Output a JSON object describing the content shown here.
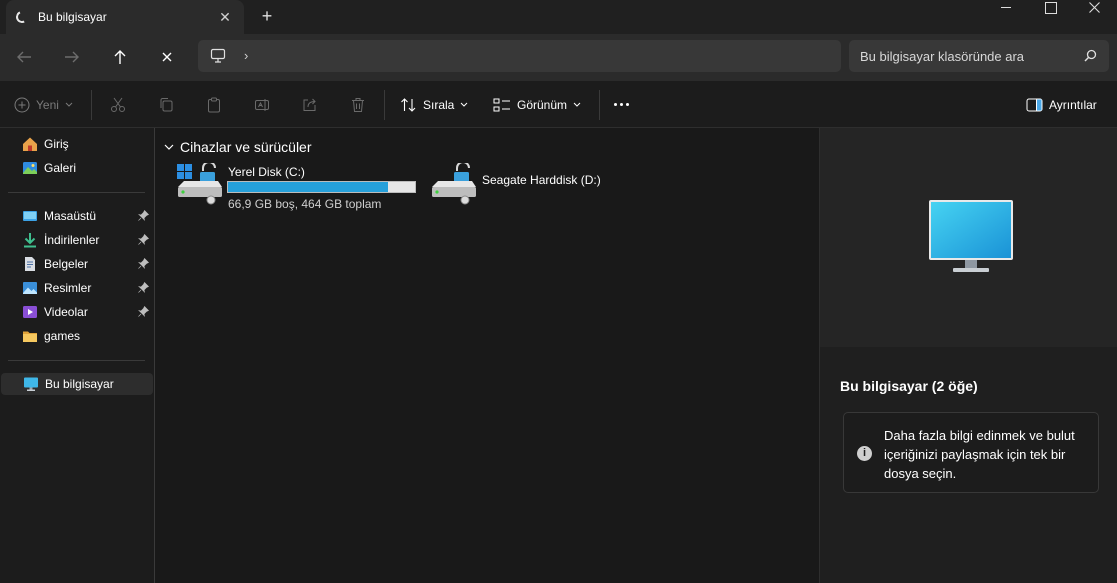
{
  "tab": {
    "title": "Bu bilgisayar"
  },
  "search": {
    "placeholder": "Bu bilgisayar klasöründe ara"
  },
  "toolbar": {
    "new_label": "Yeni",
    "sort_label": "Sırala",
    "view_label": "Görünüm",
    "details_label": "Ayrıntılar"
  },
  "sidebar": {
    "items": [
      {
        "label": "Giriş",
        "icon": "home-icon"
      },
      {
        "label": "Galeri",
        "icon": "gallery-icon"
      },
      {
        "label": "Masaüstü",
        "icon": "desktop-folder-icon",
        "pinned": true
      },
      {
        "label": "İndirilenler",
        "icon": "downloads-folder-icon",
        "pinned": true
      },
      {
        "label": "Belgeler",
        "icon": "documents-folder-icon",
        "pinned": true
      },
      {
        "label": "Resimler",
        "icon": "pictures-folder-icon",
        "pinned": true
      },
      {
        "label": "Videolar",
        "icon": "videos-folder-icon",
        "pinned": true
      },
      {
        "label": "games",
        "icon": "folder-icon",
        "pinned": false
      },
      {
        "label": "Bu bilgisayar",
        "icon": "this-pc-icon",
        "selected": true
      }
    ]
  },
  "main": {
    "group_header": "Cihazlar ve sürücüler",
    "drives": [
      {
        "name": "Yerel Disk (C:)",
        "space": "66,9 GB boş, 464 GB toplam",
        "used_fraction": 0.856
      },
      {
        "name": "Seagate Harddisk (D:)"
      }
    ]
  },
  "details": {
    "title": "Bu bilgisayar (2 öğe)",
    "info": "Daha fazla bilgi edinmek ve bulut içeriğinizi paylaşmak için tek bir dosya seçin."
  },
  "colors": {
    "accent": "#26a0da",
    "background": "#191919"
  }
}
